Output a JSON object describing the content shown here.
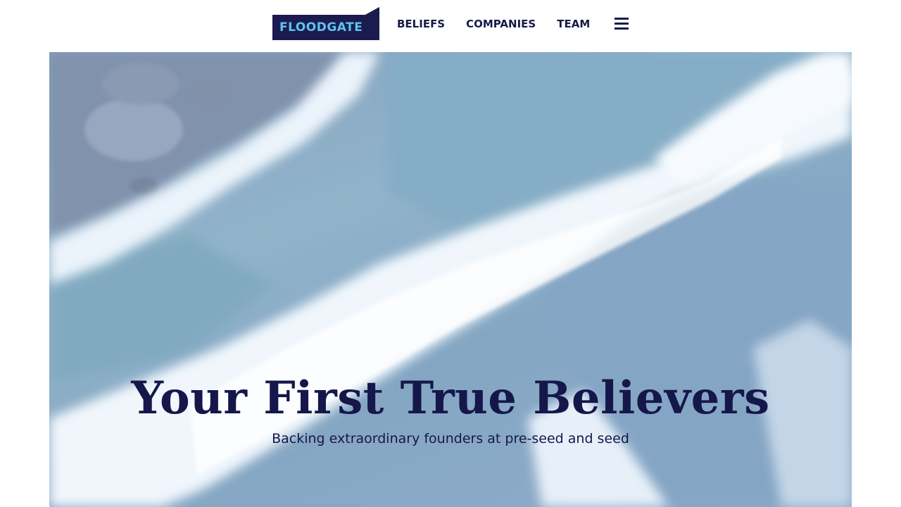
{
  "brand": {
    "name": "FLOODGATE",
    "logo_bg_color": "#1b1b4f",
    "logo_text_color": "#5cc3f0"
  },
  "nav": {
    "items": [
      {
        "label": "BELIEFS"
      },
      {
        "label": "COMPANIES"
      },
      {
        "label": "TEAM"
      }
    ],
    "menu_icon": "hamburger-menu-icon",
    "text_color": "#181a48"
  },
  "hero": {
    "title": "Your First True Believers",
    "subtitle": "Backing extraordinary founders at pre-seed and seed",
    "background": "aerial ocean waves breaking on rocks",
    "title_color": "#15174a"
  }
}
